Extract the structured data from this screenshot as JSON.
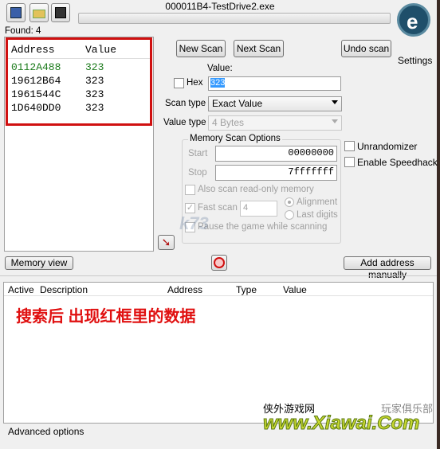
{
  "window": {
    "title": "000011B4-TestDrive2.exe"
  },
  "toolbar": {
    "icons": [
      "process-select-icon",
      "open-folder-icon",
      "save-disk-icon"
    ]
  },
  "logo": {
    "settings_label": "Settings"
  },
  "results": {
    "found_label": "Found: 4",
    "columns": [
      "Address",
      "Value"
    ],
    "rows": [
      {
        "address": "0112A488",
        "value": "323",
        "color": "#1a7a1a"
      },
      {
        "address": "19612B64",
        "value": "323"
      },
      {
        "address": "1961544C",
        "value": "323"
      },
      {
        "address": "1D640DD0",
        "value": "323"
      }
    ],
    "highlight_color": "#d01010"
  },
  "scan": {
    "new_scan": "New Scan",
    "next_scan": "Next Scan",
    "undo_scan": "Undo scan",
    "value_label": "Value:",
    "hex_label": "Hex",
    "value": "323",
    "scan_type_label": "Scan type",
    "scan_type": "Exact Value",
    "value_type_label": "Value type",
    "value_type": "4 Bytes"
  },
  "memory_options": {
    "title": "Memory Scan Options",
    "start_label": "Start",
    "start": "00000000",
    "stop_label": "Stop",
    "stop": "7fffffff",
    "readonly_label": "Also scan read-only memory",
    "fast_scan_label": "Fast scan",
    "fast_scan_value": "4",
    "alignment_label": "Alignment",
    "last_digits_label": "Last digits",
    "pause_label": "Pause the game while scanning"
  },
  "extras": {
    "unrandomizer": "Unrandomizer",
    "speedhack": "Enable Speedhack"
  },
  "bottom": {
    "memory_view": "Memory view",
    "add_address": "Add address manually",
    "advanced": "Advanced options"
  },
  "address_list": {
    "columns": [
      "Active",
      "Description",
      "Address",
      "Type",
      "Value"
    ]
  },
  "annotation": "搜索后 出现红框里的数据",
  "watermarks": {
    "k73": "k73",
    "xiawai_cn": "侠外游戏网",
    "xiawai_url": "www.Xiawai.Com",
    "club": "玩家俱乐部"
  }
}
